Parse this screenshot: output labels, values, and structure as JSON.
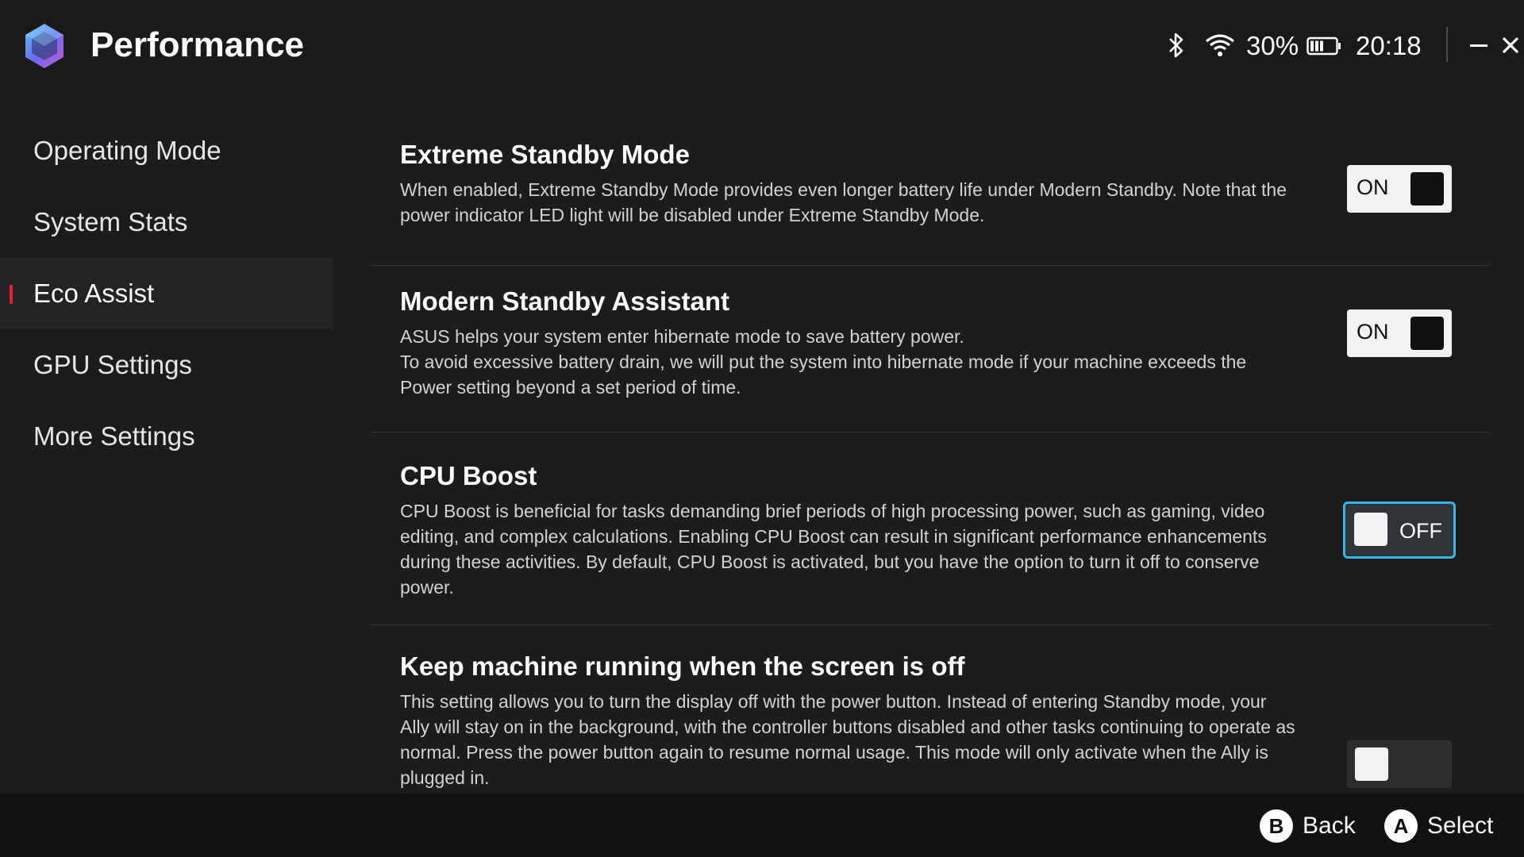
{
  "header": {
    "title": "Performance",
    "logo_icon": "armoury-crate-logo-icon",
    "status": {
      "bluetooth_icon": "bluetooth-icon",
      "wifi_icon": "wifi-icon",
      "battery_percent": "30%",
      "battery_icon": "battery-icon",
      "battery_level": 0.3,
      "time": "20:18"
    },
    "window_controls": [
      "minimize-icon",
      "close-icon"
    ]
  },
  "sidebar": {
    "items": [
      {
        "label": "Operating Mode",
        "active": false
      },
      {
        "label": "System Stats",
        "active": false
      },
      {
        "label": "Eco Assist",
        "active": true
      },
      {
        "label": "GPU Settings",
        "active": false
      },
      {
        "label": "More Settings",
        "active": false
      }
    ],
    "accent_color": "#e8202e"
  },
  "settings": [
    {
      "title": "Extreme Standby Mode",
      "description": "When enabled, Extreme Standby Mode provides even longer battery life under Modern Standby. Note that the power indicator LED light will be disabled under Extreme Standby Mode.",
      "toggle": "ON"
    },
    {
      "title": "Modern Standby Assistant",
      "description": "ASUS helps your system enter hibernate mode to save battery power.\nTo avoid excessive battery drain, we will put the system into hibernate mode if your machine exceeds the Power setting beyond a set period of time.",
      "toggle": "ON"
    },
    {
      "title": "CPU Boost",
      "description": "CPU Boost is beneficial for tasks demanding brief periods of high processing power, such as gaming, video editing, and complex calculations. Enabling CPU Boost can result in significant performance enhancements during these activities. By default, CPU Boost is activated, but you have the option to turn it off to conserve power.",
      "toggle": "OFF",
      "focused": true
    },
    {
      "title": "Keep machine running when the screen is off",
      "description": "This setting allows you to turn the display off with the power button. Instead of entering Standby mode, your Ally will stay on in the background, with the controller buttons disabled and other tasks continuing to operate as normal. Press the power button again to resume normal usage. This mode will only activate when the Ally is plugged in."
    }
  ],
  "focus_color": "#36b5e8",
  "footer": {
    "back": {
      "key": "B",
      "label": "Back"
    },
    "select": {
      "key": "A",
      "label": "Select"
    }
  }
}
